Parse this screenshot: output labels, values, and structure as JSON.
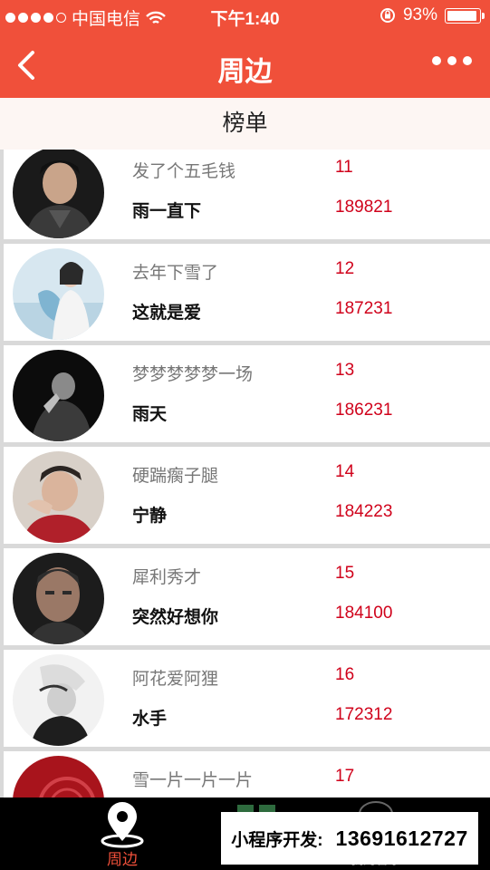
{
  "status": {
    "carrier": "中国电信",
    "time": "下午1:40",
    "battery": "93%",
    "battery_level": 0.93
  },
  "nav": {
    "title": "周边"
  },
  "section": {
    "title": "榜单"
  },
  "items": [
    {
      "song": "发了个五毛钱",
      "artist": "雨一直下",
      "rank": "11",
      "plays": "189821"
    },
    {
      "song": "去年下雪了",
      "artist": "这就是爱",
      "rank": "12",
      "plays": "187231"
    },
    {
      "song": "梦梦梦梦梦一场",
      "artist": "雨天",
      "rank": "13",
      "plays": "186231"
    },
    {
      "song": "硬踹瘸子腿",
      "artist": "宁静",
      "rank": "14",
      "plays": "184223"
    },
    {
      "song": "犀利秀才",
      "artist": "突然好想你",
      "rank": "15",
      "plays": "184100"
    },
    {
      "song": "阿花爱阿狸",
      "artist": "水手",
      "rank": "16",
      "plays": "172312"
    },
    {
      "song": "雪一片一片一片",
      "artist": "",
      "rank": "17",
      "plays": ""
    }
  ],
  "tabbar": {
    "nearby_label": "周边",
    "mine_label": "我的音乐"
  },
  "promo": {
    "label": "小程序开发:",
    "phone": "13691612727"
  },
  "colors": {
    "brand": "#f0503a",
    "accent_text": "#d0021b"
  }
}
